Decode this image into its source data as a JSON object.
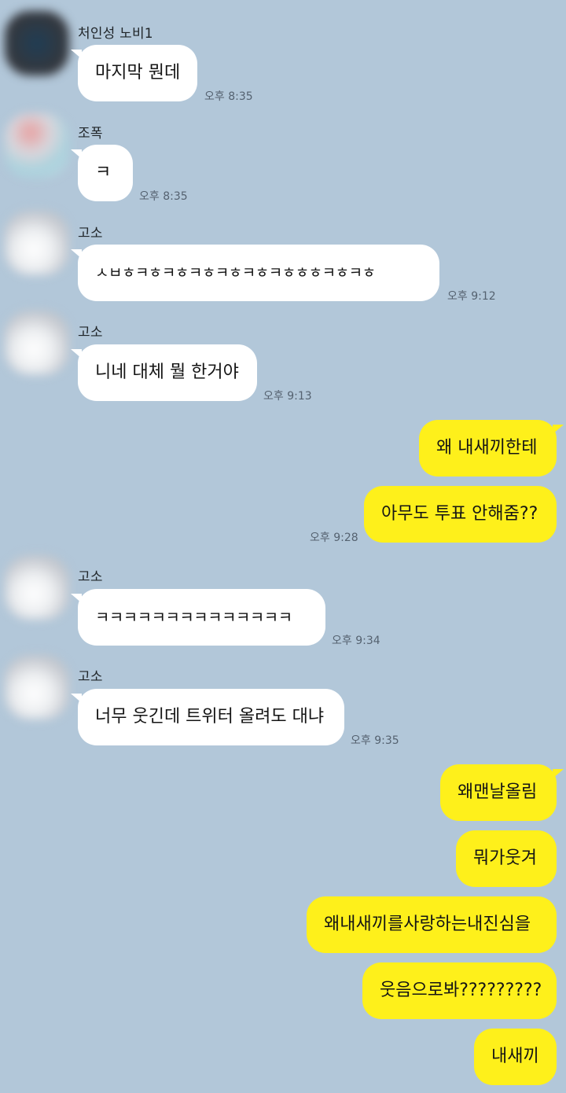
{
  "messages": [
    {
      "sender": "처인성 노비1",
      "text": "마지막 뭔데",
      "time": "오후 8:35"
    },
    {
      "sender": "조폭",
      "text": "ㅋ",
      "time": "오후 8:35"
    },
    {
      "sender": "고소",
      "text": "ㅅㅂㅎㅋㅎㅋㅎㅋㅎㅋㅎㅋㅎㅋㅎㅎㅎㅋㅎㅋㅎ",
      "time": "오후 9:12"
    },
    {
      "sender": "고소",
      "text": "니네 대체 뭘 한거야",
      "time": "오후 9:13"
    },
    {
      "text": "왜 내새끼한테"
    },
    {
      "text": "아무도 투표 안해줌??",
      "time": "오후 9:28"
    },
    {
      "sender": "고소",
      "text": "ㅋㅋㅋㅋㅋㅋㅋㅋㅋㅋㅋㅋㅋㅋ",
      "time": "오후 9:34"
    },
    {
      "sender": "고소",
      "text": "너무 웃긴데 트위터 올려도 대냐",
      "time": "오후 9:35"
    },
    {
      "text": "왜맨날올림"
    },
    {
      "text": "뭐가웃겨"
    },
    {
      "text": "왜내새끼를사랑하는내진심을"
    },
    {
      "text": "웃음으로봐?????????"
    },
    {
      "text": "내새끼"
    }
  ]
}
